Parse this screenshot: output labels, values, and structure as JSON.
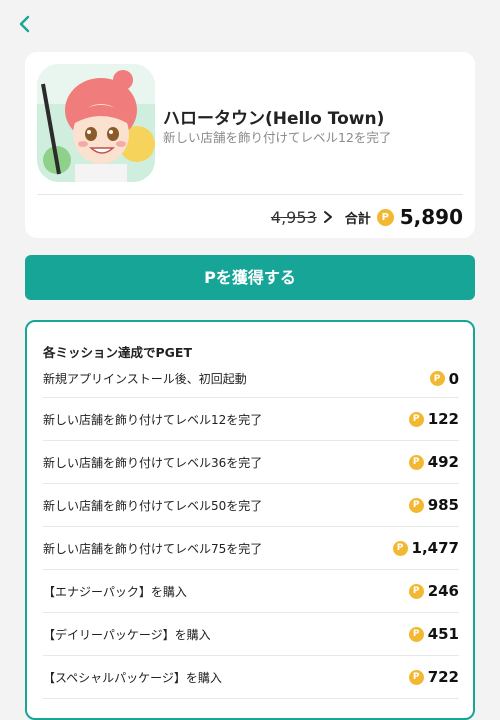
{
  "app": {
    "title": "ハロータウン(Hello Town)",
    "subtitle": "新しい店舗を飾り付けてレベル12を完了",
    "old_points": "4,953",
    "total_label": "合計",
    "total_points": "5,890",
    "coin_symbol": "P"
  },
  "cta": {
    "label": "Pを獲得する"
  },
  "missions": {
    "heading": "各ミッション達成でPGET",
    "items": [
      {
        "label": "新規アプリインストール後、初回起動",
        "points": "0"
      },
      {
        "label": "新しい店舗を飾り付けてレベル12を完了",
        "points": "122"
      },
      {
        "label": "新しい店舗を飾り付けてレベル36を完了",
        "points": "492"
      },
      {
        "label": "新しい店舗を飾り付けてレベル50を完了",
        "points": "985"
      },
      {
        "label": "新しい店舗を飾り付けてレベル75を完了",
        "points": "1,477"
      },
      {
        "label": "【エナジーパック】を購入",
        "points": "246"
      },
      {
        "label": "【デイリーパッケージ】を購入",
        "points": "451"
      },
      {
        "label": "【スペシャルパッケージ】を購入",
        "points": "722"
      }
    ]
  },
  "colors": {
    "accent": "#16a597",
    "coin": "#f2b832"
  },
  "icons": {
    "back": "chevron-left-icon",
    "arrow": "chevron-right-icon",
    "coin": "point-coin-icon"
  }
}
